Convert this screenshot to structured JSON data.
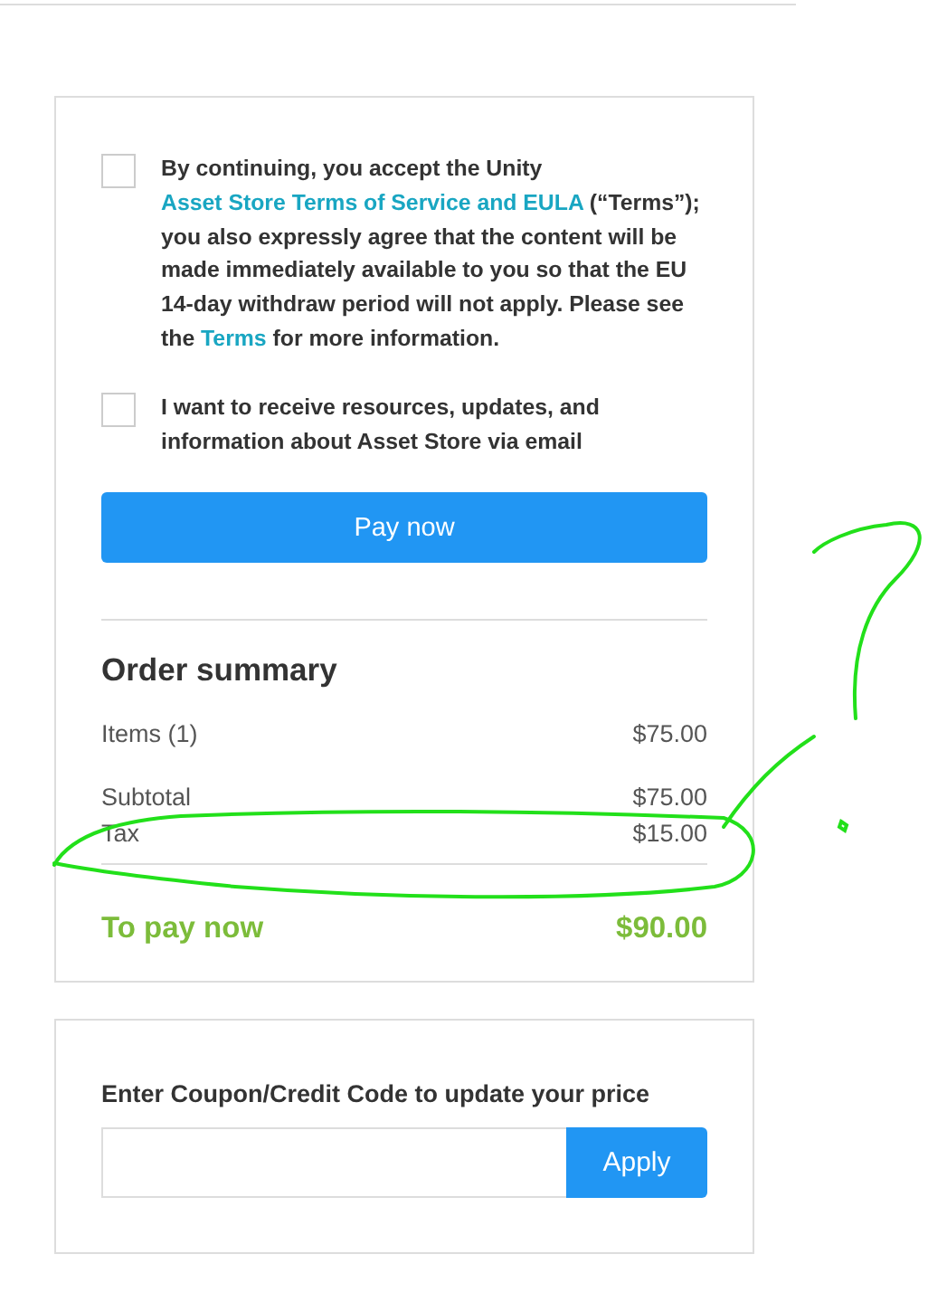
{
  "consents": [
    {
      "checked": false,
      "parts": [
        {
          "kind": "text",
          "text": "By continuing, you accept the Unity "
        },
        {
          "kind": "link",
          "text": "Asset Store "
        },
        {
          "kind": "link",
          "text": "Terms of Service and EULA"
        },
        {
          "kind": "text",
          "text": " (“Terms”); you also expressly agree that the content will be made immediately available to you so that the EU 14-day withdraw period will not apply. Please see the "
        },
        {
          "kind": "link",
          "text": "Terms"
        },
        {
          "kind": "text",
          "text": " for more information."
        }
      ]
    },
    {
      "checked": false,
      "parts": [
        {
          "kind": "text",
          "text": "I want to receive resources, updates, and information about Asset Store via email"
        }
      ]
    }
  ],
  "pay_button": "Pay now",
  "summary": {
    "title": "Order summary",
    "groups": [
      [
        {
          "label": "Items (1)",
          "amount": "$75.00"
        }
      ],
      [
        {
          "label": "Subtotal",
          "amount": "$75.00"
        },
        {
          "label": "Tax",
          "amount": "$15.00"
        }
      ]
    ],
    "total": {
      "label": "To pay now",
      "amount": "$90.00"
    }
  },
  "coupon": {
    "label": "Enter Coupon/Credit Code to update your price",
    "button": "Apply"
  }
}
